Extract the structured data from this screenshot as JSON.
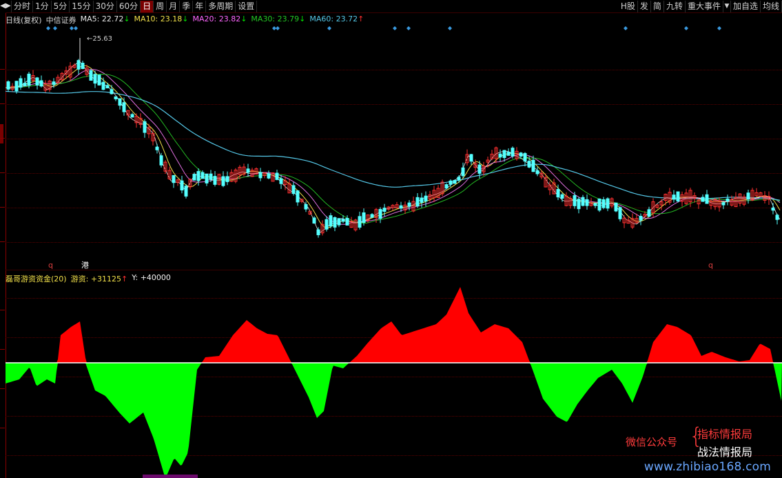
{
  "toolbar": {
    "left_icon": "◀▶",
    "left": [
      {
        "label": "分时",
        "active": false
      },
      {
        "label": "1分",
        "active": false
      },
      {
        "label": "5分",
        "active": false
      },
      {
        "label": "15分",
        "active": false
      },
      {
        "label": "30分",
        "active": false
      },
      {
        "label": "60分",
        "active": false
      },
      {
        "label": "日",
        "active": true
      },
      {
        "label": "周",
        "active": false
      },
      {
        "label": "月",
        "active": false
      },
      {
        "label": "季",
        "active": false
      },
      {
        "label": "年",
        "active": false
      },
      {
        "label": "多周期",
        "active": false
      },
      {
        "label": "设置",
        "active": false
      }
    ],
    "right": [
      {
        "label": "H股"
      },
      {
        "label": "发"
      },
      {
        "label": "简"
      },
      {
        "label": "九转"
      },
      {
        "label": "重大事件"
      }
    ],
    "dropdown_icon": "▼",
    "right2": [
      {
        "label": "加自选"
      },
      {
        "label": "均线"
      }
    ]
  },
  "main": {
    "period": "日线(复权)",
    "name": "中信证券",
    "ma": [
      {
        "label": "MA5:",
        "value": "22.72",
        "arrow": "↓",
        "color": "#e8e8e8"
      },
      {
        "label": "MA10:",
        "value": "23.18",
        "arrow": "↓",
        "color": "#f2e14a"
      },
      {
        "label": "MA20:",
        "value": "23.82",
        "arrow": "↓",
        "color": "#ff66ff"
      },
      {
        "label": "MA30:",
        "value": "23.79",
        "arrow": "↓",
        "color": "#23c823"
      },
      {
        "label": "MA60:",
        "value": "23.72",
        "arrow": "↑",
        "color": "#55c8e8"
      }
    ],
    "high_label": "25.63",
    "markers": [
      "q",
      "港",
      "q"
    ]
  },
  "sub": {
    "title": "磊哥游资资金(20)",
    "label": "游资:",
    "value": "+31125",
    "value_arrow": "↑",
    "y_label": "Y:",
    "y_value": "+40000"
  },
  "watermark": {
    "left": "微信公众号",
    "brace": "{",
    "r1": "指标情报局",
    "r2": "战法情报局",
    "url": "www.zhibiao168.com"
  },
  "colors": {
    "up": "#ff3030",
    "down": "#54ffff",
    "fund_pos": "#ff0000",
    "fund_neg": "#00ff00",
    "grid": "#5a0000"
  }
}
